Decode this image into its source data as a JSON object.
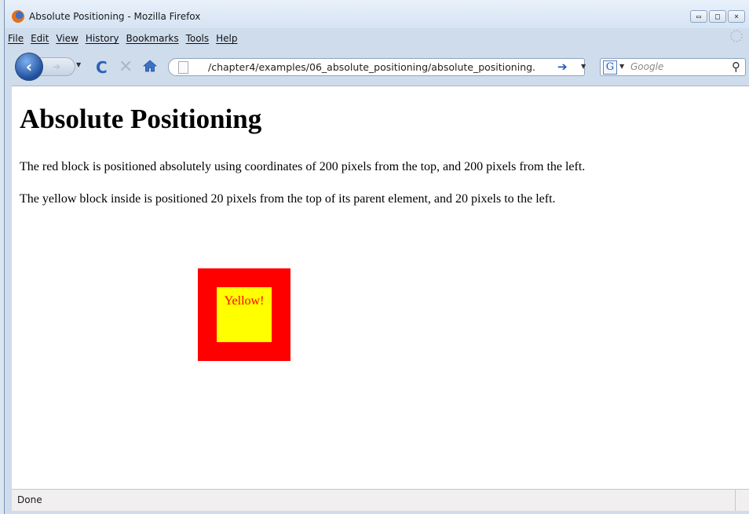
{
  "window": {
    "title": "Absolute Positioning - Mozilla Firefox",
    "controls": {
      "minimize": "▭",
      "maximize": "□",
      "close": "⨯"
    }
  },
  "menu": [
    {
      "label": "File"
    },
    {
      "label": "Edit"
    },
    {
      "label": "View"
    },
    {
      "label": "History"
    },
    {
      "label": "Bookmarks"
    },
    {
      "label": "Tools"
    },
    {
      "label": "Help"
    }
  ],
  "navigation": {
    "url": "/chapter4/examples/06_absolute_positioning/absolute_positioning.",
    "search_placeholder": "Google",
    "search_engine_letter": "G"
  },
  "page": {
    "title": "Absolute Positioning",
    "paragraph1": "The red block is positioned absolutely using coordinates of 200 pixels from the top, and 200 pixels from the left.",
    "paragraph2": "The yellow block inside is positioned 20 pixels from the top of its parent element, and 20 pixels to the left.",
    "yellow_text": "Yellow!",
    "colors": {
      "red_block": "#ff0000",
      "yellow_block": "#ffff00",
      "yellow_text": "#ff0000"
    }
  },
  "status": {
    "text": "Done"
  }
}
